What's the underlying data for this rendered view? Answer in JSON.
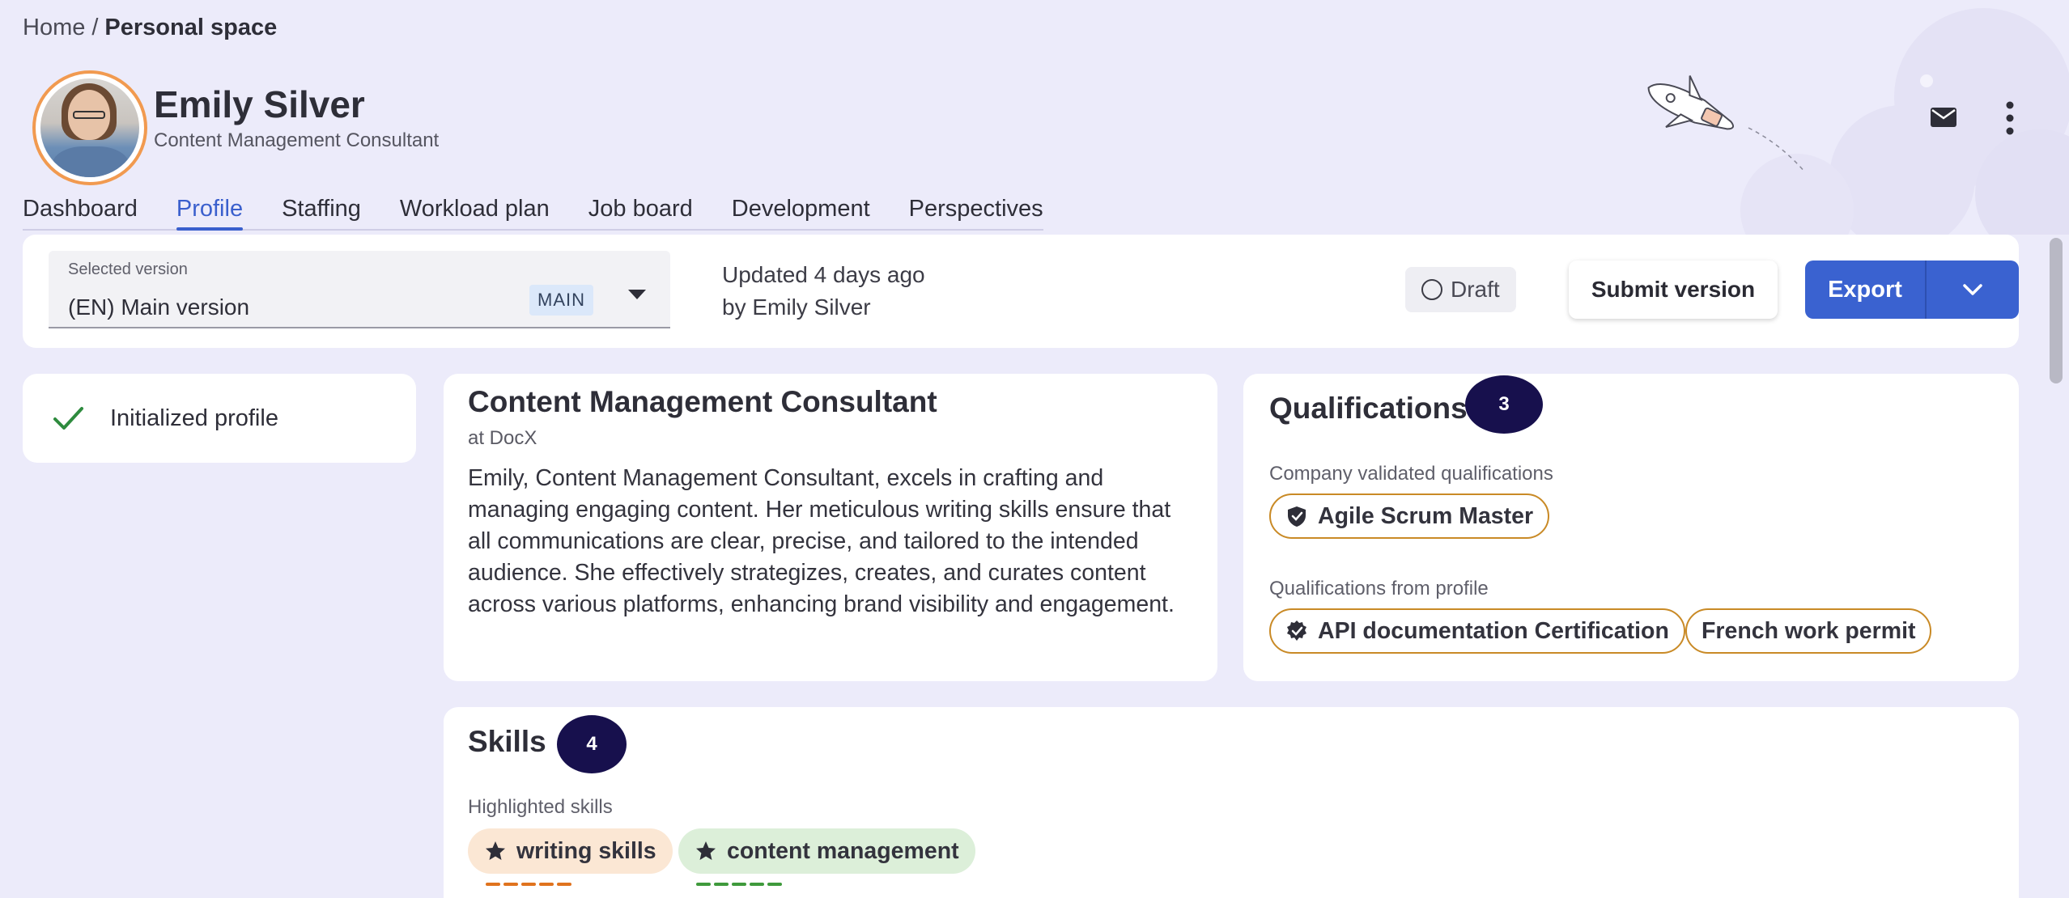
{
  "breadcrumb": {
    "home": "Home",
    "separator": "/",
    "current": "Personal space"
  },
  "profile": {
    "name": "Emily Silver",
    "role": "Content Management Consultant"
  },
  "tabs": [
    {
      "label": "Dashboard"
    },
    {
      "label": "Profile",
      "active": true
    },
    {
      "label": "Staffing"
    },
    {
      "label": "Workload plan"
    },
    {
      "label": "Job board"
    },
    {
      "label": "Development"
    },
    {
      "label": "Perspectives"
    }
  ],
  "version": {
    "label": "Selected version",
    "value": "(EN) Main version",
    "badge": "MAIN",
    "updated_line1": "Updated 4 days ago",
    "updated_line2": "by Emily Silver",
    "status": "Draft",
    "submit_label": "Submit version",
    "export_label": "Export"
  },
  "status_card": {
    "text": "Initialized profile"
  },
  "summary": {
    "title": "Content Management Consultant",
    "company": "at DocX",
    "body": "Emily, Content Management Consultant, excels in crafting and managing engaging content. Her meticulous writing skills ensure that all communications are clear, precise, and tailored to the intended audience. She effectively strategizes, creates, and curates content across various platforms, enhancing brand visibility and engagement."
  },
  "qualifications": {
    "title": "Qualifications",
    "count": "3",
    "validated_label": "Company validated qualifications",
    "validated": [
      "Agile Scrum Master"
    ],
    "profile_label": "Qualifications from profile",
    "from_profile": [
      "API documentation Certification",
      "French work permit"
    ]
  },
  "skills": {
    "title": "Skills",
    "count": "4",
    "highlighted_label": "Highlighted skills",
    "highlighted": [
      {
        "label": "writing skills",
        "color": "#fbe7d4",
        "dash_color": "#e0731e"
      },
      {
        "label": "content management",
        "color": "#dcefd9",
        "dash_color": "#3f9a3c"
      }
    ]
  },
  "colors": {
    "accent": "#3a62d0",
    "badge_dark": "#17104d",
    "chip_border": "#c98a26"
  },
  "icons": [
    "mail-icon",
    "more-vertical-icon",
    "check-icon",
    "chevron-down-icon",
    "verified-shield-icon",
    "verified-badge-icon",
    "star-icon"
  ]
}
